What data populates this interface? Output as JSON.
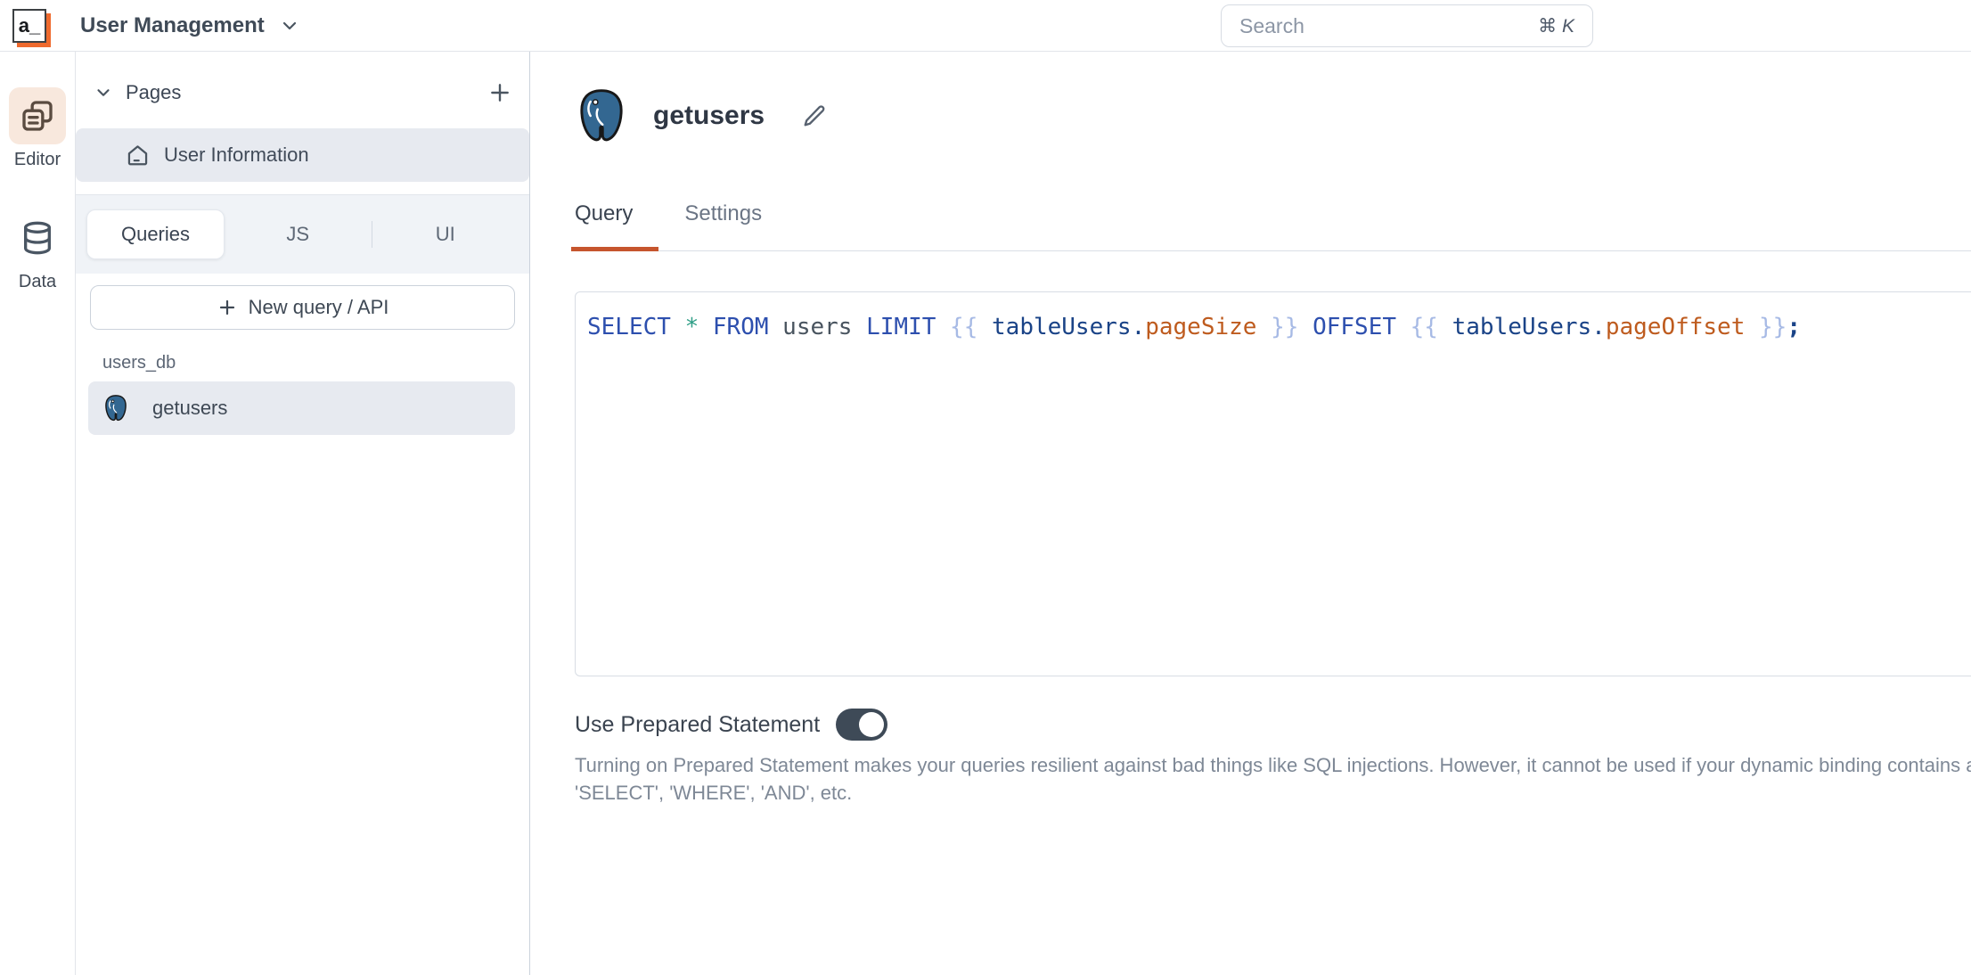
{
  "topbar": {
    "logo_text": "a_",
    "app_title": "User Management",
    "search": {
      "placeholder": "Search",
      "shortcut_cmd": "⌘",
      "shortcut_key": "K"
    }
  },
  "rail": {
    "items": [
      {
        "label": "Editor",
        "active": true
      },
      {
        "label": "Data",
        "active": false
      }
    ]
  },
  "sidebar": {
    "pages_header": "Pages",
    "pages": [
      {
        "label": "User Information",
        "selected": true
      }
    ],
    "tabs": [
      {
        "label": "Queries",
        "active": true
      },
      {
        "label": "JS",
        "active": false
      },
      {
        "label": "UI",
        "active": false
      }
    ],
    "new_query_button": "New query / API",
    "datasource_group": "users_db",
    "queries": [
      {
        "label": "getusers",
        "selected": true
      }
    ]
  },
  "main": {
    "title": "getusers",
    "tabs": [
      {
        "label": "Query",
        "active": true
      },
      {
        "label": "Settings",
        "active": false
      }
    ],
    "editor": {
      "sql": "SELECT * FROM users LIMIT {{ tableUsers.pageSize }} OFFSET {{ tableUsers.pageOffset }};",
      "tokens": [
        {
          "text": "SELECT",
          "type": "keyword"
        },
        {
          "text": " ",
          "type": "plain"
        },
        {
          "text": "*",
          "type": "star"
        },
        {
          "text": " ",
          "type": "plain"
        },
        {
          "text": "FROM",
          "type": "keyword"
        },
        {
          "text": " ",
          "type": "plain"
        },
        {
          "text": "users",
          "type": "ident"
        },
        {
          "text": " ",
          "type": "plain"
        },
        {
          "text": "LIMIT",
          "type": "keyword"
        },
        {
          "text": " ",
          "type": "plain"
        },
        {
          "text": "{{",
          "type": "brace"
        },
        {
          "text": " ",
          "type": "plain"
        },
        {
          "text": "tableUsers",
          "type": "binding"
        },
        {
          "text": ".",
          "type": "binding"
        },
        {
          "text": "pageSize",
          "type": "prop"
        },
        {
          "text": " ",
          "type": "plain"
        },
        {
          "text": "}}",
          "type": "brace"
        },
        {
          "text": " ",
          "type": "plain"
        },
        {
          "text": "OFFSET",
          "type": "keyword"
        },
        {
          "text": " ",
          "type": "plain"
        },
        {
          "text": "{{",
          "type": "brace"
        },
        {
          "text": " ",
          "type": "plain"
        },
        {
          "text": "tableUsers",
          "type": "binding"
        },
        {
          "text": ".",
          "type": "binding"
        },
        {
          "text": "pageOffset",
          "type": "prop"
        },
        {
          "text": " ",
          "type": "plain"
        },
        {
          "text": "}}",
          "type": "brace"
        },
        {
          "text": ";",
          "type": "semi"
        }
      ]
    },
    "prepared_statement": {
      "label": "Use Prepared Statement",
      "enabled": true,
      "description_line1": "Turning on Prepared Statement makes your queries resilient against bad things like SQL injections. However, it cannot be used if your dynamic binding contains any SQL keywords like",
      "description_line2": "'SELECT', 'WHERE', 'AND', etc."
    }
  },
  "colors": {
    "accent_orange": "#C6552D",
    "logo_orange": "#EF6A2E",
    "selected_row_bg": "#E7EAF0",
    "toggle_on": "#3E4A57",
    "postgres_blue": "#336791"
  }
}
